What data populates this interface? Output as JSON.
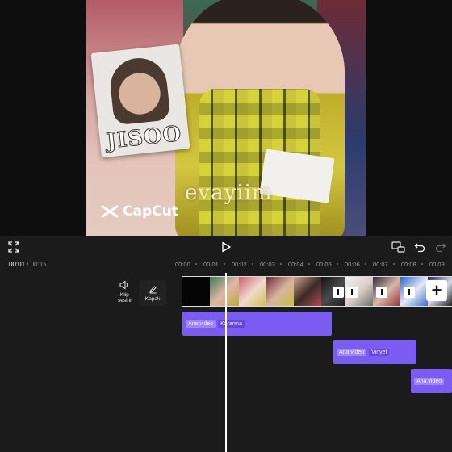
{
  "preview": {
    "photo_text": "JISOO",
    "watermark_text": "evayiim",
    "brand_logo_text": "CapCut"
  },
  "toolbar": {
    "fullscreen_icon": "expand-icon",
    "play_icon": "play-icon",
    "keyframe_icon": "keyframe-icon",
    "undo_icon": "undo-icon",
    "redo_icon": "redo-icon"
  },
  "timeline": {
    "current_time": "00:01",
    "separator": "/",
    "total_time": "00:15",
    "ruler_ticks": [
      "00:00",
      "00:01",
      "00:02",
      "00:03",
      "00:04",
      "00:05",
      "00:06",
      "00:07",
      "00:08",
      "00:09"
    ]
  },
  "controls": {
    "clip_audio_label_line1": "Klip",
    "clip_audio_label_line2": "sesini",
    "cover_label": "Kapak"
  },
  "tracks": [
    {
      "tag": "Ana video",
      "effect": "Kararma"
    },
    {
      "tag": "Ana video",
      "effect": "Vinyet"
    },
    {
      "tag": "Ana video",
      "effect": ""
    }
  ],
  "colors": {
    "accent": "#7a5cf0",
    "background": "#1b1b1b"
  }
}
